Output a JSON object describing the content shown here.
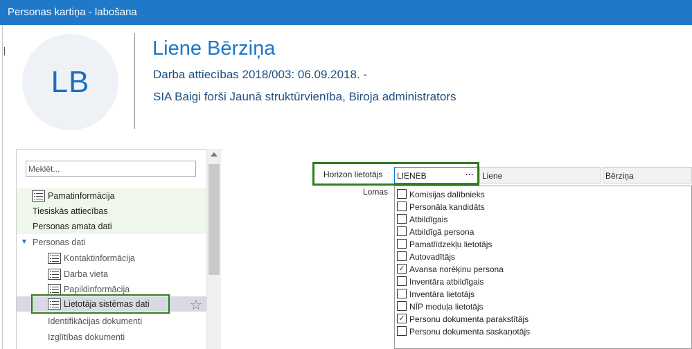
{
  "window": {
    "title": "Personas kartiņa - labošana"
  },
  "header": {
    "initials": "LB",
    "name": "Liene Bērziņa",
    "employment": "Darba attiecības 2018/003: 06.09.2018. -",
    "organization": "SIA Baigi forši Jaunā struktūrvienība, Biroja administrators"
  },
  "nav": {
    "search_placeholder": "Meklēt...",
    "items": [
      {
        "label": "Pamatinformācija"
      },
      {
        "label": "Tiesiskās attiecības"
      },
      {
        "label": "Personas amata dati"
      },
      {
        "label": "Personas dati"
      },
      {
        "label": "Kontaktinformācija"
      },
      {
        "label": "Darba vieta"
      },
      {
        "label": "Papildinformācija"
      },
      {
        "label": "Lietotāja sistēmas dati"
      },
      {
        "label": "Identifikācijas dokumenti"
      },
      {
        "label": "Izglītības dokumenti"
      }
    ]
  },
  "form": {
    "horizon_label": "Horizon lietotājs",
    "horizon_user": "LIENEB",
    "lookup_button": "···",
    "first_name": "Liene",
    "last_name": "Bērziņa",
    "roles_label": "Lomas",
    "roles": [
      {
        "label": "Komisijas dalībnieks",
        "checked": false
      },
      {
        "label": "Personāla kandidāts",
        "checked": false
      },
      {
        "label": "Atbildīgais",
        "checked": false
      },
      {
        "label": "Atbildīgā persona",
        "checked": false
      },
      {
        "label": "Pamatlīdzekļu lietotājs",
        "checked": false
      },
      {
        "label": "Autovadītājs",
        "checked": false
      },
      {
        "label": "Avansa norēķinu persona",
        "checked": true
      },
      {
        "label": "Inventāra atbildīgais",
        "checked": false
      },
      {
        "label": "Inventāra lietotājs",
        "checked": false
      },
      {
        "label": "NĪP moduļa lietotājs",
        "checked": false
      },
      {
        "label": "Personu dokumenta parakstītājs",
        "checked": true
      },
      {
        "label": "Personu dokumenta saskaņotājs",
        "checked": false
      }
    ]
  }
}
